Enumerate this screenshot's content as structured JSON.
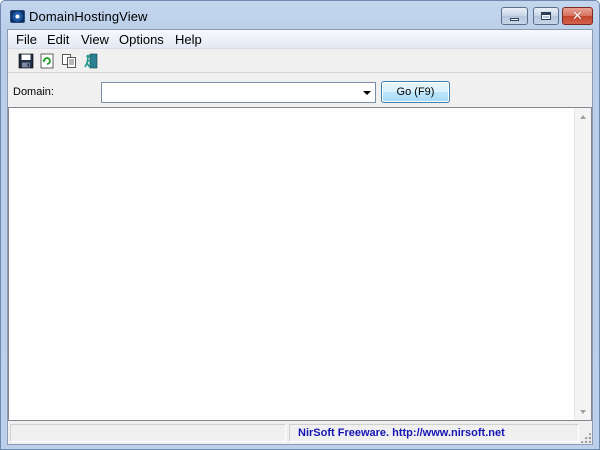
{
  "window": {
    "title": "DomainHostingView",
    "controls": {
      "minimize": "minimize",
      "maximize": "maximize",
      "close": "✕"
    }
  },
  "menu": {
    "items": [
      "File",
      "Edit",
      "View",
      "Options",
      "Help"
    ]
  },
  "toolbar": {
    "buttons": [
      {
        "icon": "save-icon"
      },
      {
        "icon": "refresh-icon"
      },
      {
        "icon": "copy-icon"
      },
      {
        "icon": "exit-icon"
      }
    ]
  },
  "domain": {
    "label": "Domain:",
    "value": "",
    "placeholder": "",
    "go_button": "Go   (F9)"
  },
  "list": {
    "rows": []
  },
  "status": {
    "left_text": "",
    "right_text": "NirSoft Freeware.  http://www.nirsoft.net",
    "link_color": "#1515b4"
  }
}
